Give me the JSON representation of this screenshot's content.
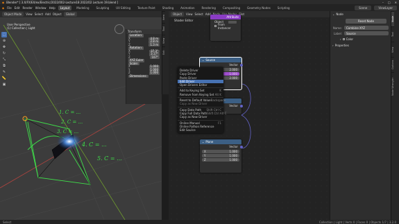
{
  "titlebar": {
    "title": "Blender* [ 3.X/FX/EX/ex/Electric/2022/002-Lecture18 2022/02 Lecture 19.blend ]",
    "controls": [
      "–",
      "□",
      "✕"
    ]
  },
  "menubar": {
    "logo": "◆",
    "menus": [
      "File",
      "Edit",
      "Render",
      "Window",
      "Help"
    ],
    "workspaces": [
      "Layout",
      "Modeling",
      "Sculpting",
      "UV Editing",
      "Texture Paint",
      "Shading",
      "Animation",
      "Rendering",
      "Compositing",
      "Geometry Nodes",
      "Scripting"
    ],
    "active_workspace": "Layout",
    "scene": "Scene",
    "view_layer": "ViewLayer"
  },
  "viewport": {
    "header": {
      "mode": "Object Mode",
      "menus": [
        "View",
        "Select",
        "Add",
        "Object"
      ],
      "global": "Global"
    },
    "info_line1": "User Perspective",
    "info_line2": "(1) Collection | Light",
    "npanel": {
      "section": "Transform",
      "location_label": "Location:",
      "location": [
        [
          "X",
          "4.8 m"
        ],
        [
          "Y",
          "2.8 m"
        ],
        [
          "Z",
          "1.3 m"
        ]
      ],
      "rotation_label": "Rotation:",
      "rotation": [
        [
          "X",
          "37.3°"
        ],
        [
          "Y",
          "3.17°"
        ],
        [
          "Z",
          "107°"
        ]
      ],
      "mode": "XYZ Euler",
      "scale_label": "Scale:",
      "scale": [
        [
          "X",
          "1.000"
        ],
        [
          "Y",
          "1.000"
        ],
        [
          "Z",
          "1.000"
        ]
      ],
      "dims_label": "Dimensions:"
    },
    "handwriting": [
      "1. C = ...",
      "2. C = ...",
      "3. C = ...",
      "4. C = ...",
      "5. C = ..."
    ]
  },
  "vtabs": [
    "Item",
    "Tool",
    "View",
    "Edit"
  ],
  "node_editor": {
    "header": {
      "editor": "Object",
      "menus": [
        "View",
        "Select",
        "Add",
        "Node"
      ],
      "use_nodes": "Use Nodes",
      "slot": "Slot"
    },
    "breadcrumb": "Shader Editor",
    "attr_node": {
      "title": "Attribute",
      "object_label": "Object",
      "from_instancer": "From Instancer"
    },
    "source_node": {
      "title": "Source",
      "output": "Vector",
      "values": [
        "2.000",
        "1.000",
        "2.000"
      ]
    },
    "middle_node": {
      "output": "Vector"
    },
    "plane_node": {
      "title": "Plane",
      "output": "Vector",
      "fields": [
        [
          "X",
          "1.000"
        ],
        [
          "Y",
          "1.000"
        ],
        [
          "Z",
          "1.000"
        ]
      ]
    },
    "context_menu": {
      "items": [
        {
          "label": "Delete Driver",
          "shortcut": ""
        },
        {
          "label": "Copy Driver",
          "shortcut": ""
        },
        {
          "label": "Paste Driver",
          "shortcut": ""
        },
        {
          "label": "Edit Driver",
          "shortcut": "",
          "highlight": true
        },
        {
          "label": "Open Drivers Editor",
          "shortcut": ""
        },
        {
          "label": "---"
        },
        {
          "label": "Add to Keying Set",
          "shortcut": "K"
        },
        {
          "label": "Remove from Keying Set",
          "shortcut": "Alt K"
        },
        {
          "label": "---"
        },
        {
          "label": "Reset to Default Value",
          "shortcut": "Backspace"
        },
        {
          "label": "Copy as New Driver",
          "shortcut": "",
          "dim": true
        },
        {
          "label": "---"
        },
        {
          "label": "Copy Data Path",
          "shortcut": "Shift Ctrl C"
        },
        {
          "label": "Copy Full Data Path",
          "shortcut": "Shift Ctrl Alt C"
        },
        {
          "label": "Copy as New Driver",
          "shortcut": ""
        },
        {
          "label": "---"
        },
        {
          "label": "Online Manual",
          "shortcut": "F1"
        },
        {
          "label": "Online Python Reference",
          "shortcut": ""
        },
        {
          "label": "Edit Source",
          "shortcut": ""
        }
      ]
    }
  },
  "sidebar": {
    "section": "Node",
    "reset_label": "Reset Node",
    "name_label": "Name:",
    "name_value": "Combine XYZ",
    "label_label": "Label:",
    "label_value": "Source",
    "color_label": "Color",
    "properties_label": "Properties"
  },
  "sbtabs": [
    "Node",
    "Tool",
    "View",
    "Options",
    "Node Wrangler"
  ],
  "statusbar": {
    "left": "Select",
    "right": "Collection | Light | Verts 0 | Faces 0 | Objects 1/7 | 3.2.0"
  }
}
